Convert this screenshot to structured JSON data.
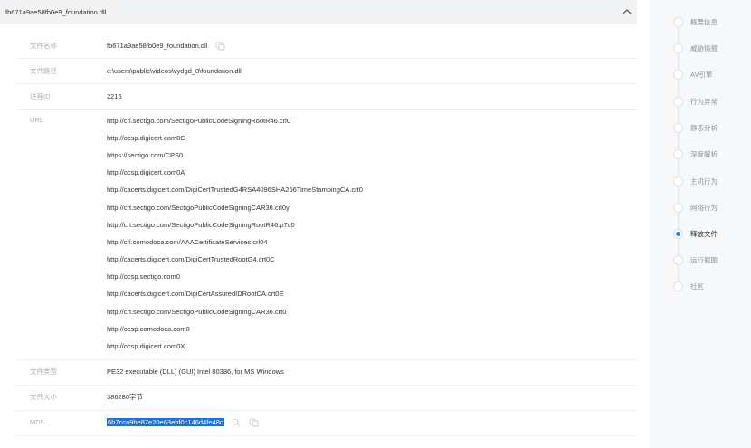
{
  "panel": {
    "title": "fb671a9ae58fb0e9_foundation.dll",
    "collapse_icon": "chevron-up-icon"
  },
  "fields": {
    "file_name": {
      "label": "文件名称",
      "value": "fb671a9ae58fb0e9_foundation.dll"
    },
    "file_path": {
      "label": "文件路径",
      "value": "c:\\users\\public\\videos\\vydgd_8\\foundation.dll"
    },
    "process_id": {
      "label": "进程ID",
      "value": "2216"
    },
    "url": {
      "label": "URL",
      "values": [
        "http://crl.sectigo.com/SectigoPublicCodeSigningRootR46.crl0",
        "http://ocsp.digicert.com0C",
        "https://sectigo.com/CPS0",
        "http://ocsp.digicert.com0A",
        "http://cacerts.digicert.com/DigiCertTrustedG4RSA4096SHA256TimeStampingCA.crt0",
        "http://crt.sectigo.com/SectigoPublicCodeSigningCAR36.crl0y",
        "http://crt.sectigo.com/SectigoPublicCodeSigningRootR46.p7c0",
        "http://crl.comodoca.com/AAACertificateServices.crl04",
        "http://cacerts.digicert.com/DigiCertTrustedRootG4.crt0C",
        "http://ocsp.sectigo.com0",
        "http://cacerts.digicert.com/DigiCertAssuredIDRootCA.crt0E",
        "http://crt.sectigo.com/SectigoPublicCodeSigningCAR36.crt0",
        "http://ocsp.comodoca.com0",
        "http://ocsp.digicert.com0X"
      ]
    },
    "file_type": {
      "label": "文件类型",
      "value": "PE32 executable (DLL) (GUI) Intel 80386, for MS Windows"
    },
    "file_size": {
      "label": "文件大小",
      "value": "386280字节"
    },
    "md5": {
      "label": "MD5",
      "value": "6b7cca9be87e20e63ebf0c146d4fe48c"
    }
  },
  "side_nav": {
    "items": [
      {
        "label": "概要信息",
        "active": false
      },
      {
        "label": "威胁情报",
        "active": false
      },
      {
        "label": "AV引擎",
        "active": false
      },
      {
        "label": "行为异常",
        "active": false
      },
      {
        "label": "静态分析",
        "active": false
      },
      {
        "label": "深度解析",
        "active": false
      },
      {
        "label": "主机行为",
        "active": false
      },
      {
        "label": "网络行为",
        "active": false
      },
      {
        "label": "释放文件",
        "active": true
      },
      {
        "label": "运行截图",
        "active": false
      },
      {
        "label": "社区",
        "active": false
      }
    ],
    "active_color": "#2b7de9"
  },
  "colors": {
    "md5_highlight": "#1e6fd9",
    "header_bg": "#f2f3f5",
    "sidebar_bg": "#f7f8fa"
  }
}
